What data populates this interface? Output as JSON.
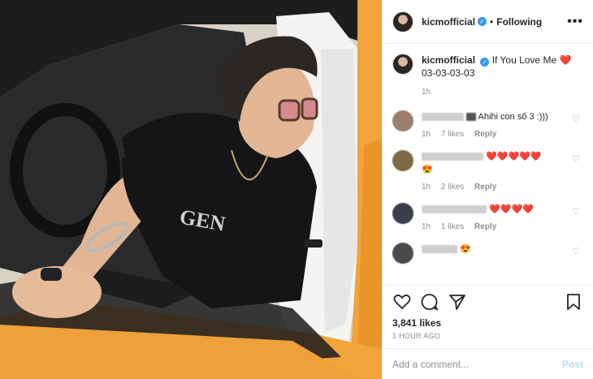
{
  "header": {
    "username": "kicmofficial",
    "verified_glyph": "✓",
    "separator": "•",
    "follow_status": "Following",
    "more_label": "•••"
  },
  "caption": {
    "username": "kicmofficial",
    "text": "If You Love Me",
    "emoji": "❤️",
    "line2": "03-03-03-03",
    "time": "1h"
  },
  "comments": [
    {
      "text": "Ahihi con số 3 :)))",
      "time": "1h",
      "likes": "7 likes",
      "reply": "Reply"
    },
    {
      "text": "❤️❤️❤️❤️❤️",
      "text2": "😍",
      "time": "1h",
      "likes": "2 likes",
      "reply": "Reply"
    },
    {
      "text": "❤️❤️❤️❤️",
      "time": "1h",
      "likes": "1 likes",
      "reply": "Reply"
    },
    {
      "text": "😍"
    }
  ],
  "likes_count": "3,841 likes",
  "posted_ago": "1 HOUR AGO",
  "comment_input": {
    "placeholder": "Add a comment...",
    "post_label": "Post"
  },
  "colors": {
    "verified": "#3897f0",
    "post_disabled": "#b2dffc",
    "car_yellow": "#f2a33a"
  },
  "icons": [
    "heart-outline-icon",
    "comment-bubble-icon",
    "share-paper-plane-icon",
    "bookmark-icon"
  ]
}
